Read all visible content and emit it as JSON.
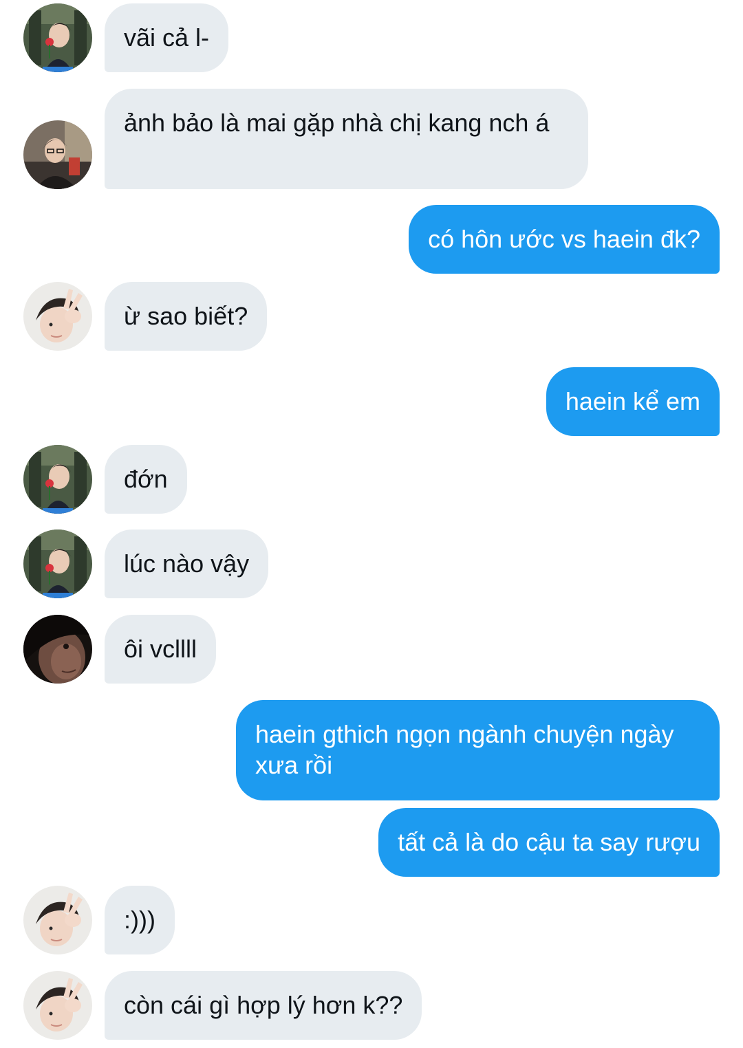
{
  "messages": [
    {
      "direction": "in",
      "avatar": "boy-red-flower-avatar",
      "text": "vãi cả l-"
    },
    {
      "direction": "in",
      "avatar": "boy-glasses-avatar",
      "text": "ảnh bảo là mai gặp nhà chị kang nch á"
    },
    {
      "direction": "out",
      "text": "có hôn ước vs haein đk?"
    },
    {
      "direction": "in",
      "avatar": "boy-peace-sign-avatar",
      "text": "ừ sao biết?"
    },
    {
      "direction": "out",
      "text": "haein kể em"
    },
    {
      "direction": "in",
      "avatar": "boy-red-flower-avatar",
      "text": "đớn"
    },
    {
      "direction": "in",
      "avatar": "boy-red-flower-avatar",
      "text": "lúc nào vậy"
    },
    {
      "direction": "in",
      "avatar": "dark-face-avatar",
      "text": "ôi vcllll"
    },
    {
      "direction": "out",
      "text": "haein gthich ngọn ngành chuyện ngày xưa rồi"
    },
    {
      "direction": "out",
      "text": "tất cả là do cậu ta say rượu"
    },
    {
      "direction": "in",
      "avatar": "boy-peace-sign-avatar",
      "text": ":)))"
    },
    {
      "direction": "in",
      "avatar": "boy-peace-sign-avatar",
      "text": "còn cái gì hợp lý hơn k??"
    }
  ],
  "colors": {
    "incoming_bubble": "#e7ecf0",
    "outgoing_bubble": "#1d9bf0",
    "incoming_text": "#0f1419",
    "outgoing_text": "#ffffff"
  }
}
